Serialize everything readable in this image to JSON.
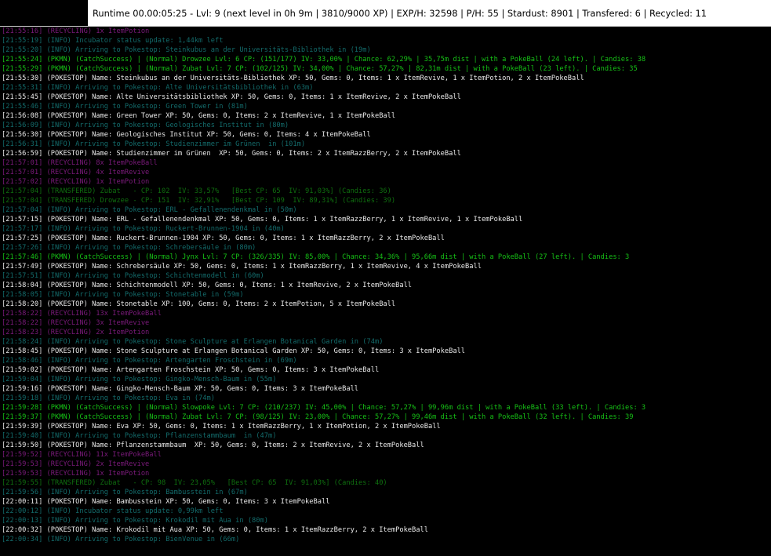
{
  "window": {
    "title": "Runtime 00.00:05:25 - Lvl: 9 (next level in 0h 9m | 3810/9000 XP) | EXP/H: 32598 | P/H: 55 | Stardust: 8901 | Transfered: 6 | Recycled: 11"
  },
  "colors": {
    "recycling": "#7a1a7a",
    "info": "#136b6b",
    "catch": "#16c016",
    "pokestop": "#e8e8e8",
    "transfered": "#0f6e0f",
    "background": "#000000"
  },
  "log": [
    {
      "type": "recycling",
      "text": "[21:55:16] (RECYCLING) 1x ItemPotion"
    },
    {
      "type": "info",
      "text": "[21:55:19] (INFO) Incubator status update: 1,44km left"
    },
    {
      "type": "info",
      "text": "[21:55:20] (INFO) Arriving to Pokestop: Steinkubus an der Universitäts-Bibliothek in (19m)"
    },
    {
      "type": "catch",
      "text": "[21:55:24] (PKMN) (CatchSuccess) | (Normal) Drowzee Lvl: 6 CP: (151/177) IV: 33,00% | Chance: 62,29% | 35,75m dist | with a PokeBall (24 left). | Candies: 38"
    },
    {
      "type": "catch",
      "text": "[21:55:29] (PKMN) (CatchSuccess) | (Normal) Zubat Lvl: 7 CP: (102/125) IV: 34,00% | Chance: 57,27% | 82,31m dist | with a PokeBall (23 left). | Candies: 35"
    },
    {
      "type": "pokestop",
      "text": "[21:55:30] (POKESTOP) Name: Steinkubus an der Universitäts-Bibliothek XP: 50, Gems: 0, Items: 1 x ItemRevive, 1 x ItemPotion, 2 x ItemPokeBall"
    },
    {
      "type": "info",
      "text": "[21:55:31] (INFO) Arriving to Pokestop: Alte Universitätsbibliothek in (63m)"
    },
    {
      "type": "pokestop",
      "text": "[21:55:45] (POKESTOP) Name: Alte Universitätsbibliothek XP: 50, Gems: 0, Items: 1 x ItemRevive, 2 x ItemPokeBall"
    },
    {
      "type": "info",
      "text": "[21:55:46] (INFO) Arriving to Pokestop: Green Tower in (81m)"
    },
    {
      "type": "pokestop",
      "text": "[21:56:08] (POKESTOP) Name: Green Tower XP: 50, Gems: 0, Items: 2 x ItemRevive, 1 x ItemPokeBall"
    },
    {
      "type": "info",
      "text": "[21:56:09] (INFO) Arriving to Pokestop: Geologisches Institut in (80m)"
    },
    {
      "type": "pokestop",
      "text": "[21:56:30] (POKESTOP) Name: Geologisches Institut XP: 50, Gems: 0, Items: 4 x ItemPokeBall"
    },
    {
      "type": "info",
      "text": "[21:56:31] (INFO) Arriving to Pokestop: Studienzimmer im Grünen  in (101m)"
    },
    {
      "type": "pokestop",
      "text": "[21:56:59] (POKESTOP) Name: Studienzimmer im Grünen  XP: 50, Gems: 0, Items: 2 x ItemRazzBerry, 2 x ItemPokeBall"
    },
    {
      "type": "recycling",
      "text": "[21:57:01] (RECYCLING) 8x ItemPokeBall"
    },
    {
      "type": "recycling",
      "text": "[21:57:01] (RECYCLING) 4x ItemRevive"
    },
    {
      "type": "recycling",
      "text": "[21:57:02] (RECYCLING) 1x ItemPotion"
    },
    {
      "type": "transfered",
      "text": "[21:57:04] (TRANSFERED) Zubat   - CP: 102  IV: 33,57%   [Best CP: 65  IV: 91,03%] (Candies: 36)"
    },
    {
      "type": "transfered",
      "text": "[21:57:04] (TRANSFERED) Drowzee - CP: 151  IV: 32,91%   [Best CP: 109  IV: 89,31%] (Candies: 39)"
    },
    {
      "type": "info",
      "text": "[21:57:04] (INFO) Arriving to Pokestop: ERL - Gefallenendenkmal in (50m)"
    },
    {
      "type": "pokestop",
      "text": "[21:57:15] (POKESTOP) Name: ERL - Gefallenendenkmal XP: 50, Gems: 0, Items: 1 x ItemRazzBerry, 1 x ItemRevive, 1 x ItemPokeBall"
    },
    {
      "type": "info",
      "text": "[21:57:17] (INFO) Arriving to Pokestop: Ruckert-Brunnen-1904 in (40m)"
    },
    {
      "type": "pokestop",
      "text": "[21:57:25] (POKESTOP) Name: Ruckert-Brunnen-1904 XP: 50, Gems: 0, Items: 1 x ItemRazzBerry, 2 x ItemPokeBall"
    },
    {
      "type": "info",
      "text": "[21:57:26] (INFO) Arriving to Pokestop: Schrebersäule in (80m)"
    },
    {
      "type": "catch",
      "text": "[21:57:46] (PKMN) (CatchSuccess) | (Normal) Jynx Lvl: 7 CP: (326/335) IV: 85,00% | Chance: 34,36% | 95,66m dist | with a PokeBall (27 left). | Candies: 3"
    },
    {
      "type": "pokestop",
      "text": "[21:57:49] (POKESTOP) Name: Schrebersäule XP: 50, Gems: 0, Items: 1 x ItemRazzBerry, 1 x ItemRevive, 4 x ItemPokeBall"
    },
    {
      "type": "info",
      "text": "[21:57:51] (INFO) Arriving to Pokestop: Schichtenmodell in (60m)"
    },
    {
      "type": "pokestop",
      "text": "[21:58:04] (POKESTOP) Name: Schichtenmodell XP: 50, Gems: 0, Items: 1 x ItemRevive, 2 x ItemPokeBall"
    },
    {
      "type": "info",
      "text": "[21:58:05] (INFO) Arriving to Pokestop: Stonetable in (59m)"
    },
    {
      "type": "pokestop",
      "text": "[21:58:20] (POKESTOP) Name: Stonetable XP: 100, Gems: 0, Items: 2 x ItemPotion, 5 x ItemPokeBall"
    },
    {
      "type": "recycling",
      "text": "[21:58:22] (RECYCLING) 13x ItemPokeBall"
    },
    {
      "type": "recycling",
      "text": "[21:58:22] (RECYCLING) 3x ItemRevive"
    },
    {
      "type": "recycling",
      "text": "[21:58:23] (RECYCLING) 2x ItemPotion"
    },
    {
      "type": "info",
      "text": "[21:58:24] (INFO) Arriving to Pokestop: Stone Sculpture at Erlangen Botanical Garden in (74m)"
    },
    {
      "type": "pokestop",
      "text": "[21:58:45] (POKESTOP) Name: Stone Sculpture at Erlangen Botanical Garden XP: 50, Gems: 0, Items: 3 x ItemPokeBall"
    },
    {
      "type": "info",
      "text": "[21:58:46] (INFO) Arriving to Pokestop: Artengarten Froschstein in (69m)"
    },
    {
      "type": "pokestop",
      "text": "[21:59:02] (POKESTOP) Name: Artengarten Froschstein XP: 50, Gems: 0, Items: 3 x ItemPokeBall"
    },
    {
      "type": "info",
      "text": "[21:59:04] (INFO) Arriving to Pokestop: Gingko-Mensch-Baum in (55m)"
    },
    {
      "type": "pokestop",
      "text": "[21:59:16] (POKESTOP) Name: Gingko-Mensch-Baum XP: 50, Gems: 0, Items: 3 x ItemPokeBall"
    },
    {
      "type": "info",
      "text": "[21:59:18] (INFO) Arriving to Pokestop: Eva in (74m)"
    },
    {
      "type": "catch",
      "text": "[21:59:28] (PKMN) (CatchSuccess) | (Normal) Slowpoke Lvl: 7 CP: (210/237) IV: 45,00% | Chance: 57,27% | 99,96m dist | with a PokeBall (33 left). | Candies: 3"
    },
    {
      "type": "catch",
      "text": "[21:59:37] (PKMN) (CatchSuccess) | (Normal) Zubat Lvl: 7 CP: (98/125) IV: 23,00% | Chance: 57,27% | 99,46m dist | with a PokeBall (32 left). | Candies: 39"
    },
    {
      "type": "pokestop",
      "text": "[21:59:39] (POKESTOP) Name: Eva XP: 50, Gems: 0, Items: 1 x ItemRazzBerry, 1 x ItemPotion, 2 x ItemPokeBall"
    },
    {
      "type": "info",
      "text": "[21:59:40] (INFO) Arriving to Pokestop: Pflanzenstammbaum  in (47m)"
    },
    {
      "type": "pokestop",
      "text": "[21:59:50] (POKESTOP) Name: Pflanzenstammbaum  XP: 50, Gems: 0, Items: 2 x ItemRevive, 2 x ItemPokeBall"
    },
    {
      "type": "recycling",
      "text": "[21:59:52] (RECYCLING) 11x ItemPokeBall"
    },
    {
      "type": "recycling",
      "text": "[21:59:53] (RECYCLING) 2x ItemRevive"
    },
    {
      "type": "recycling",
      "text": "[21:59:53] (RECYCLING) 1x ItemPotion"
    },
    {
      "type": "transfered",
      "text": "[21:59:55] (TRANSFERED) Zubat   - CP: 98  IV: 23,05%   [Best CP: 65  IV: 91,03%] (Candies: 40)"
    },
    {
      "type": "info",
      "text": "[21:59:56] (INFO) Arriving to Pokestop: Bambusstein in (67m)"
    },
    {
      "type": "pokestop",
      "text": "[22:00:11] (POKESTOP) Name: Bambusstein XP: 50, Gems: 0, Items: 3 x ItemPokeBall"
    },
    {
      "type": "info",
      "text": "[22:00:12] (INFO) Incubator status update: 0,99km left"
    },
    {
      "type": "info",
      "text": "[22:00:13] (INFO) Arriving to Pokestop: Krokodil mit Aua in (80m)"
    },
    {
      "type": "pokestop",
      "text": "[22:00:32] (POKESTOP) Name: Krokodil mit Aua XP: 50, Gems: 0, Items: 1 x ItemRazzBerry, 2 x ItemPokeBall"
    },
    {
      "type": "info",
      "text": "[22:00:34] (INFO) Arriving to Pokestop: BienVenue in (66m)"
    }
  ]
}
